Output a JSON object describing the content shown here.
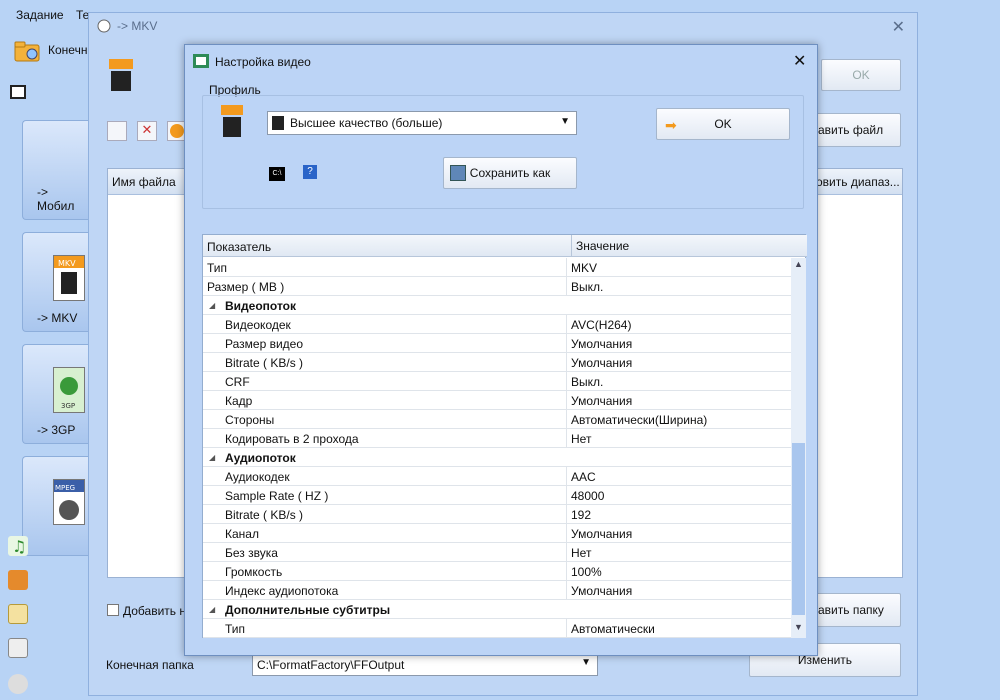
{
  "main": {
    "menu": [
      "Задание",
      "Те"
    ],
    "toolbar_label": "Конечн",
    "categories": [
      {
        "label": "-> Мобил"
      },
      {
        "label": "-> MKV"
      },
      {
        "label": "-> 3GP"
      },
      {
        "label": ""
      }
    ],
    "icons": {
      "mkv": "MKV",
      "threegp": "3GP",
      "mpeg": "MPEG"
    }
  },
  "mkv_window": {
    "title": "-> MKV",
    "ok_label": "OK",
    "add_file_label": "авить файл",
    "columns": {
      "filename": "Имя файла",
      "range": "овить диапаз..."
    },
    "add_check_label": "Добавить на",
    "add_folder_label": "авить папку",
    "output_label": "Конечная папка",
    "output_path": "C:\\FormatFactory\\FFOutput",
    "change_label": "Изменить"
  },
  "dialog": {
    "title": "Настройка видео",
    "profile_label": "Профиль",
    "profile_value": "Высшее качество (больше)",
    "ok_label": "OK",
    "save_as_label": "Сохранить как",
    "cmd_icon_text": "C:\\",
    "help_icon_text": "?",
    "grid_headers": {
      "name": "Показатель",
      "value": "Значение"
    },
    "rows": [
      {
        "name": "Тип",
        "value": "MKV",
        "kind": "top"
      },
      {
        "name": "Размер ( MB )",
        "value": "Выкл.",
        "kind": "top"
      },
      {
        "name": "Видеопоток",
        "value": "",
        "kind": "group"
      },
      {
        "name": "Видеокодек",
        "value": "AVC(H264)",
        "kind": "child"
      },
      {
        "name": "Размер видео",
        "value": "Умолчания",
        "kind": "child"
      },
      {
        "name": "Bitrate ( KB/s )",
        "value": "Умолчания",
        "kind": "child"
      },
      {
        "name": "CRF",
        "value": "Выкл.",
        "kind": "child"
      },
      {
        "name": "Кадр",
        "value": "Умолчания",
        "kind": "child"
      },
      {
        "name": "Стороны",
        "value": "Автоматически(Ширина)",
        "kind": "child"
      },
      {
        "name": "Кодировать в 2 прохода",
        "value": "Нет",
        "kind": "child"
      },
      {
        "name": "Аудиопоток",
        "value": "",
        "kind": "group"
      },
      {
        "name": "Аудиокодек",
        "value": "AAC",
        "kind": "child"
      },
      {
        "name": "Sample Rate ( HZ )",
        "value": "48000",
        "kind": "child"
      },
      {
        "name": "Bitrate ( KB/s )",
        "value": "192",
        "kind": "child"
      },
      {
        "name": "Канал",
        "value": "Умолчания",
        "kind": "child"
      },
      {
        "name": "Без звука",
        "value": "Нет",
        "kind": "child"
      },
      {
        "name": "Громкость",
        "value": "100%",
        "kind": "child"
      },
      {
        "name": "Индекс аудиопотока",
        "value": "Умолчания",
        "kind": "child"
      },
      {
        "name": "Дополнительные субтитры",
        "value": "",
        "kind": "group"
      },
      {
        "name": "Тип",
        "value": "Автоматически",
        "kind": "child"
      }
    ]
  },
  "colors": {
    "background": "#b8d3f5",
    "scroll_thumb": "#a9c6ee",
    "accent_orange": "#f39a1e"
  }
}
